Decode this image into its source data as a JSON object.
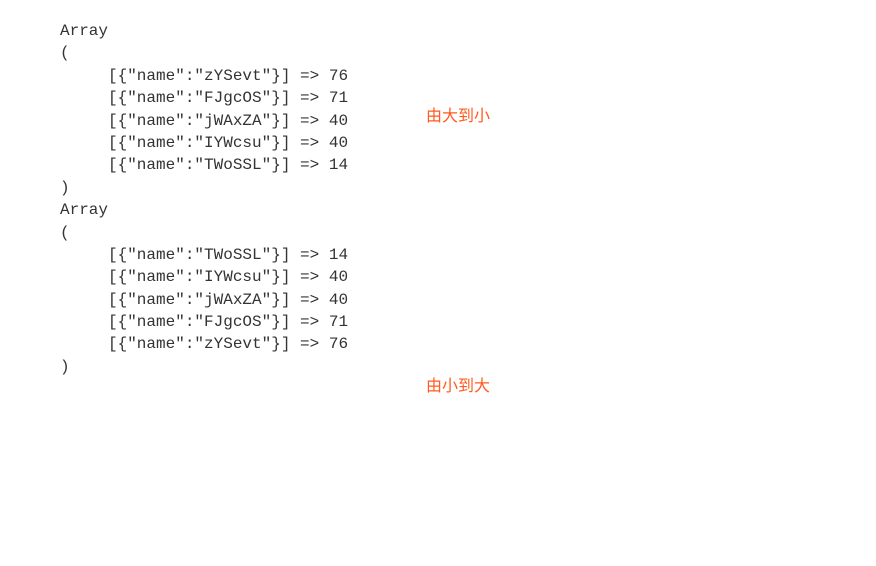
{
  "block1": {
    "open": "Array",
    "paren_open": "(",
    "rows": [
      {
        "text": "[{\"name\":\"zYSevt\"}] => 76"
      },
      {
        "text": "[{\"name\":\"FJgcOS\"}] => 71"
      },
      {
        "text": "[{\"name\":\"jWAxZA\"}] => 40"
      },
      {
        "text": "[{\"name\":\"IYWcsu\"}] => 40"
      },
      {
        "text": "[{\"name\":\"TWoSSL\"}] => 14"
      }
    ],
    "paren_close": ")",
    "annotation": "由大到小"
  },
  "block2": {
    "open": "Array",
    "paren_open": "(",
    "rows": [
      {
        "text": "[{\"name\":\"TWoSSL\"}] => 14"
      },
      {
        "text": "[{\"name\":\"IYWcsu\"}] => 40"
      },
      {
        "text": "[{\"name\":\"jWAxZA\"}] => 40"
      },
      {
        "text": "[{\"name\":\"FJgcOS\"}] => 71"
      },
      {
        "text": "[{\"name\":\"zYSevt\"}] => 76"
      }
    ],
    "paren_close": ")",
    "annotation": "由小到大"
  }
}
